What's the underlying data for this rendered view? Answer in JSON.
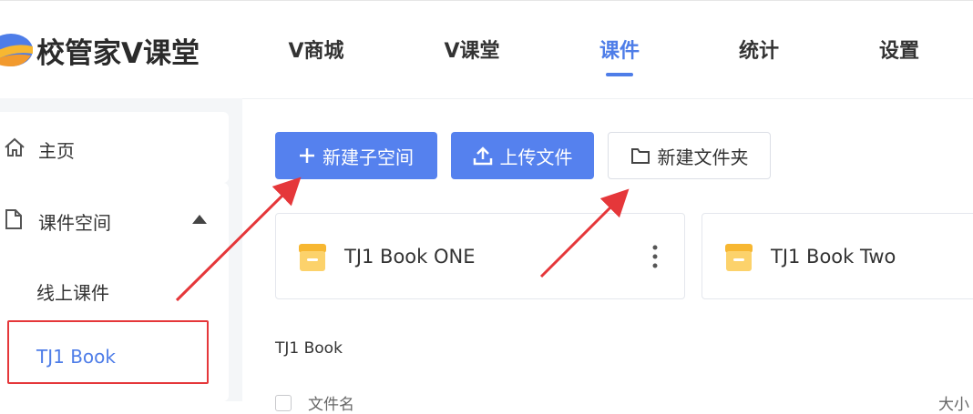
{
  "header": {
    "logo_text": "校管家V课堂",
    "nav": [
      {
        "label": "V商城"
      },
      {
        "label": "V课堂"
      },
      {
        "label": "课件"
      },
      {
        "label": "统计"
      },
      {
        "label": "设置"
      }
    ],
    "active_nav": "课件"
  },
  "sidebar": {
    "home_label": "主页",
    "space_label": "课件空间",
    "sub_items": [
      {
        "label": "线上课件"
      },
      {
        "label": "TJ1 Book"
      }
    ]
  },
  "toolbar": {
    "new_subspace_label": "新建子空间",
    "upload_label": "上传文件",
    "new_folder_label": "新建文件夹"
  },
  "folders": [
    {
      "name": "TJ1 Book ONE"
    },
    {
      "name": "TJ1 Book Two"
    }
  ],
  "breadcrumb": "TJ1 Book",
  "table": {
    "col_name": "文件名",
    "col_size": "大小"
  },
  "colors": {
    "accent": "#4e7de8",
    "primary_button": "#5581ee",
    "annotation_red": "#e5373a",
    "folder_yellow": "#fbc84b"
  }
}
